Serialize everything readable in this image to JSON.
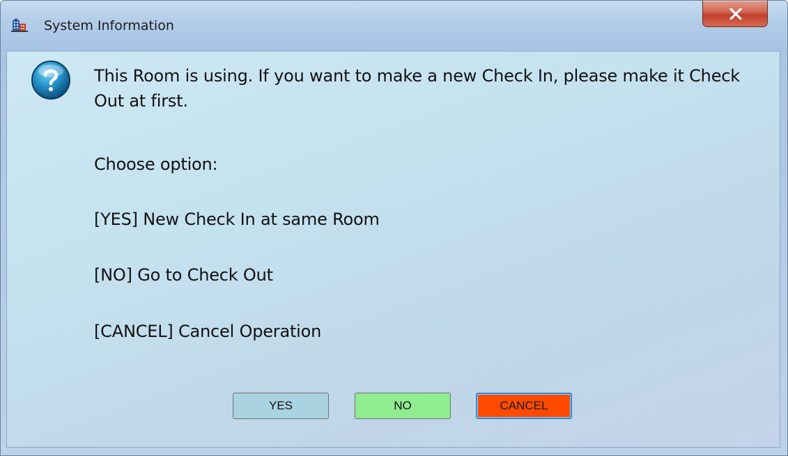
{
  "window": {
    "title": "System Information",
    "close_glyph": "X",
    "app_icon": "hotel-building-icon"
  },
  "dialog": {
    "icon": "question-icon",
    "message_main": "This Room is using. If you want to make a new Check In, please make it Check Out at first.",
    "choose_label": "Choose option:",
    "option_yes": "[YES] New Check In at same Room",
    "option_no": "[NO] Go to Check Out",
    "option_cancel": "[CANCEL] Cancel Operation"
  },
  "buttons": {
    "yes_label": "YES",
    "no_label": "NO",
    "cancel_label": "CANCEL"
  },
  "colors": {
    "yes_button": "#a9d3e0",
    "no_button": "#8fec8f",
    "cancel_button": "#ff4a00",
    "focus_border": "#2e8bd6",
    "close_button": "#c0402c"
  }
}
